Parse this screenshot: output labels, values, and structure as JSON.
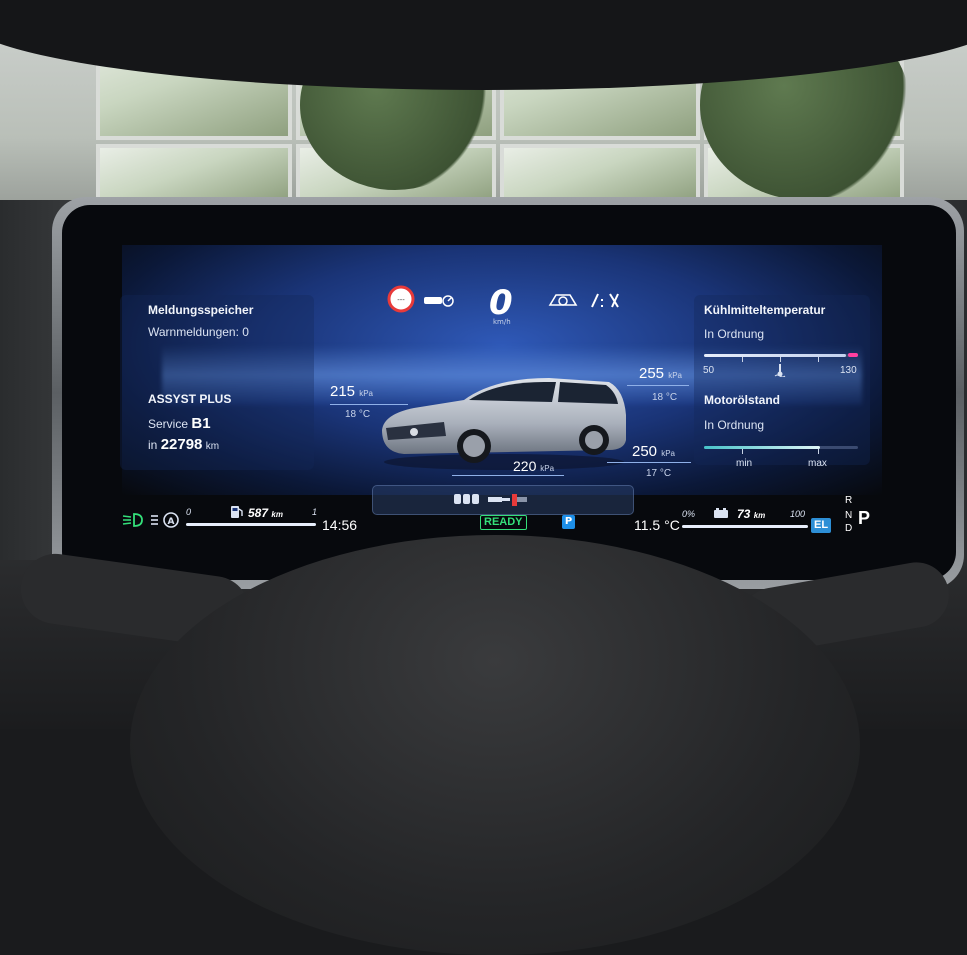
{
  "left_panel": {
    "message_title": "Meldungsspeicher",
    "warnings": "Warnmeldungen: 0",
    "service_title": "ASSYST PLUS",
    "service_label": "Service",
    "service_code": "B1",
    "distance_prefix": "in",
    "distance_value": "22798",
    "distance_unit": "km"
  },
  "speed": {
    "value": "0",
    "unit": "km/h"
  },
  "tires": {
    "front_left": {
      "pressure": "215",
      "unit": "kPa",
      "temp": "18 °C"
    },
    "front_right": {
      "pressure": "255",
      "unit": "kPa",
      "temp": "18 °C"
    },
    "rear_left": {
      "pressure": "220",
      "unit": "kPa"
    },
    "rear_right": {
      "pressure": "250",
      "unit": "kPa",
      "temp": "17 °C"
    }
  },
  "right_panel": {
    "coolant_title": "Kühlmitteltemperatur",
    "coolant_status": "In Ordnung",
    "coolant_min": "50",
    "coolant_max": "130",
    "coolant_level": 0.92,
    "oil_title": "Motorölstand",
    "oil_status": "In Ordnung",
    "oil_min": "min",
    "oil_max": "max",
    "oil_level": 0.75
  },
  "bottom_left": {
    "fuel_min": "0",
    "range_value": "587",
    "range_unit": "km",
    "fuel_max": "1",
    "time": "14:56"
  },
  "bottom_center": {
    "ready": "READY",
    "park": "P"
  },
  "bottom_right": {
    "outside_temp": "11.5 °C",
    "battery_min": "0%",
    "electric_range": "73",
    "electric_unit": "km",
    "battery_max": "100",
    "mode": "EL",
    "gears": {
      "r": "R",
      "n": "N",
      "p": "P",
      "d": "D"
    }
  },
  "colors": {
    "ready_green": "#34e07a",
    "accent_blue": "#2d8fd6",
    "warning_red": "#e83a3a",
    "gauge_max_pink": "#ff3fa0"
  }
}
